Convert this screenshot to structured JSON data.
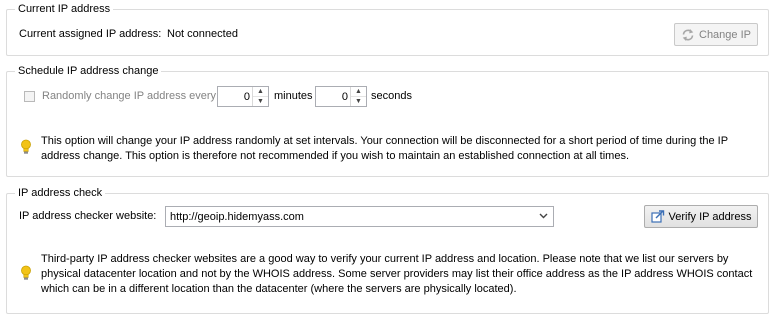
{
  "current_ip": {
    "legend": "Current IP address",
    "label": "Current assigned IP address:",
    "value": "Not connected",
    "change_button": "Change IP",
    "change_icon": "refresh-icon"
  },
  "schedule": {
    "legend": "Schedule IP address change",
    "checkbox_label": "Randomly change IP address every",
    "checked": false,
    "minutes_value": "0",
    "minutes_label": "minutes",
    "seconds_value": "0",
    "seconds_label": "seconds",
    "info_icon": "lightbulb-icon",
    "info": "This option will change your IP address randomly at set intervals. Your connection will be disconnected for a short period of time during the IP address change. This option is therefore not recommended if you wish to maintain an established connection at all times."
  },
  "ip_check": {
    "legend": "IP address check",
    "checker_label": "IP address checker website:",
    "checker_value": "http://geoip.hidemyass.com",
    "verify_button": "Verify IP address",
    "verify_icon": "external-link-icon",
    "info_icon": "lightbulb-icon",
    "info": "Third-party IP address checker websites are a good way to verify your current IP address and location. Please note that we list our servers by physical datacenter location and not by the WHOIS address. Some server providers may list their office address as the IP address WHOIS contact which can be in a different location than the datacenter (where the servers are physically located)."
  },
  "colors": {
    "bulb": "#f2c317",
    "disabled_text": "#838383",
    "group_border": "#dcdcdc"
  }
}
